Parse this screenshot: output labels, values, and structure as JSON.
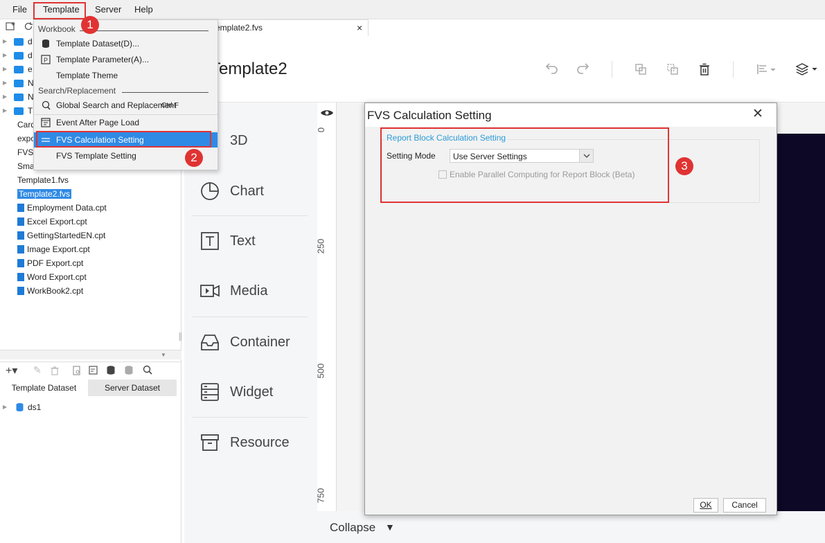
{
  "menubar": {
    "file": "File",
    "template": "Template",
    "server": "Server",
    "help": "Help"
  },
  "tab": {
    "title": "emplate2.fvs",
    "close": "×"
  },
  "header": {
    "title": "Template2"
  },
  "tree": {
    "folders": [
      "d",
      "d",
      "e",
      "N",
      "N",
      "T"
    ],
    "truncated": [
      "Card",
      "expo",
      "FVS",
      "Sma"
    ],
    "files": [
      "Template1.fvs",
      "Template2.fvs"
    ],
    "cpt_files": [
      "Employment Data.cpt",
      "Excel Export.cpt",
      "GettingStartedEN.cpt",
      "Image Export.cpt",
      "PDF Export.cpt",
      "Word Export.cpt",
      "WorkBook2.cpt"
    ]
  },
  "dataset": {
    "tab_template": "Template Dataset",
    "tab_server": "Server Dataset",
    "item": "ds1"
  },
  "components": {
    "c3d": "3D",
    "chart": "Chart",
    "text": "Text",
    "media": "Media",
    "container": "Container",
    "widget": "Widget",
    "resource": "Resource"
  },
  "ruler": {
    "t0": "0",
    "t250": "250",
    "t500": "500",
    "t750": "750"
  },
  "bottom": {
    "collapse": "Collapse"
  },
  "dropdown": {
    "section_workbook": "Workbook",
    "template_dataset": "Template Dataset(D)...",
    "template_parameter": "Template Parameter(A)...",
    "template_theme": "Template Theme",
    "section_search": "Search/Replacement",
    "global_search": "Global Search and Replacement",
    "global_search_shortcut": "Ctrl-F",
    "event_after_load": "Event After Page Load",
    "fvs_calc": "FVS Calculation Setting",
    "fvs_template": "FVS Template Setting"
  },
  "dialog": {
    "title": "FVS Calculation Setting",
    "close": "✕",
    "group_title": "Report Block Calculation Setting",
    "setting_mode_label": "Setting Mode",
    "setting_mode_value": "Use Server Settings",
    "parallel_label": "Enable Parallel Computing for Report Block (Beta)",
    "ok": "OK",
    "cancel": "Cancel"
  },
  "badges": {
    "b1": "1",
    "b2": "2",
    "b3": "3"
  },
  "colors": {
    "accent": "#2f8ae5",
    "highlight_red": "#e03333",
    "canvas_dark": "#0c0825",
    "group_title": "#2a9ad6"
  }
}
